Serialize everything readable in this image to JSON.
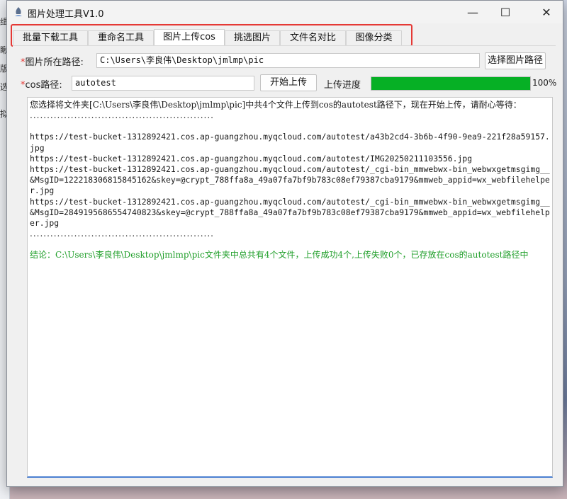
{
  "background_window": {
    "fragments": [
      "缉",
      "瞅",
      "版",
      "选",
      "拟"
    ]
  },
  "window": {
    "title": "图片处理工具V1.0",
    "controls": {
      "minimize": "—",
      "maximize": "☐",
      "close": "✕"
    }
  },
  "tabs": [
    {
      "label": "批量下载工具",
      "active": false
    },
    {
      "label": "重命名工具",
      "active": false
    },
    {
      "label": "图片上传cos",
      "active": true
    },
    {
      "label": "挑选图片",
      "active": false
    },
    {
      "label": "文件名对比",
      "active": false
    },
    {
      "label": "图像分类",
      "active": false
    }
  ],
  "form": {
    "path_label_star": "*",
    "path_label": "图片所在路径:",
    "path_value": "C:\\Users\\李良伟\\Desktop\\jmlmp\\pic",
    "select_path_button": "选择图片路径",
    "cos_label_star": "*",
    "cos_label": "cos路径:",
    "cos_value": "autotest",
    "start_upload_button": "开始上传",
    "progress_label": "上传进度",
    "progress_percent_text": "100%",
    "progress_value": 1.0
  },
  "log": {
    "intro": "您选择将文件夹[C:\\Users\\李良伟\\Desktop\\jmlmp\\pic]中共4个文件上传到cos的autotest路径下，现在开始上传，请耐心等待：",
    "separator_top": "......................................................",
    "urls": [
      "https://test-bucket-1312892421.cos.ap-guangzhou.myqcloud.com/autotest/a43b2cd4-3b6b-4f90-9ea9-221f28a59157.jpg",
      "https://test-bucket-1312892421.cos.ap-guangzhou.myqcloud.com/autotest/IMG20250211103556.jpg",
      "https://test-bucket-1312892421.cos.ap-guangzhou.myqcloud.com/autotest/_cgi-bin_mmwebwx-bin_webwxgetmsgimg__&MsgID=1222183068158451​62&skey=@crypt_788ffa8a_49a07fa7bf9b783c08ef79387cba9179&mmweb_appid=wx_webfilehelper.jpg",
      "https://test-bucket-1312892421.cos.ap-guangzhou.myqcloud.com/autotest/_cgi-bin_mmwebwx-bin_webwxgetmsgimg__&MsgID=2849195686554740823&skey=@crypt_788ffa8a_49a07fa7bf9b783c08ef79387cba9179&mmweb_appid=wx_webfilehelper.jpg"
    ],
    "separator_bottom": "......................................................",
    "conclusion": "结论：C:\\Users\\李良伟\\Desktop\\jmlmp\\pic文件夹中总共有4个文件，上传成功4个,上传失败0个，已存放在cos的autotest路径中"
  },
  "colors": {
    "required_star": "#e53935",
    "progress_fill": "#06b025",
    "conclusion_text": "#1e9e28",
    "tab_highlight_border": "#e53935"
  }
}
